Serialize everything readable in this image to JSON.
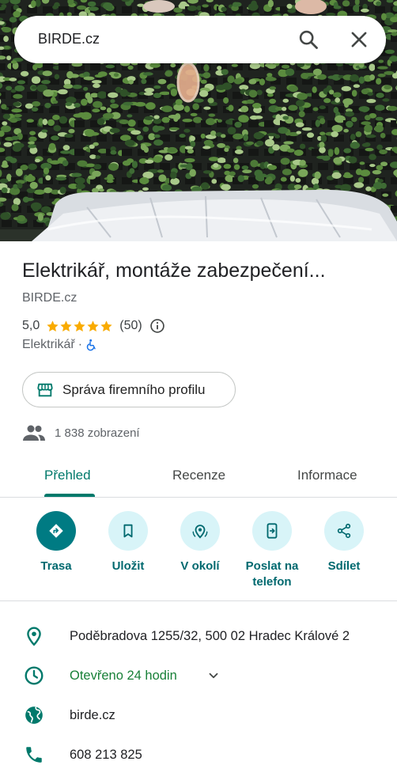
{
  "search": {
    "query": "BIRDE.cz"
  },
  "place": {
    "title": "Elektrikář, montáže zabezpečení...",
    "subtitle": "BIRDE.cz",
    "rating": "5,0",
    "review_count": "(50)",
    "category": "Elektrikář",
    "separator": "·",
    "manage_profile_label": "Správa firemního profilu",
    "views": "1 838 zobrazení"
  },
  "tabs": [
    {
      "label": "Přehled",
      "active": true
    },
    {
      "label": "Recenze",
      "active": false
    },
    {
      "label": "Informace",
      "active": false
    }
  ],
  "actions": [
    {
      "label": "Trasa",
      "icon": "directions-icon"
    },
    {
      "label": "Uložit",
      "icon": "bookmark-icon"
    },
    {
      "label": "V okolí",
      "icon": "nearby-icon"
    },
    {
      "label": "Poslat na telefon",
      "icon": "send-to-phone-icon"
    },
    {
      "label": "Sdílet",
      "icon": "share-icon"
    }
  ],
  "details": {
    "address": "Poděbradova 1255/32, 500 02 Hradec Králové 2",
    "hours": "Otevřeno 24 hodin",
    "website": "birde.cz",
    "phone": "608 213 825"
  },
  "colors": {
    "accent": "#00796b",
    "action_bg": "#d8f4f8",
    "action_primary": "#007b83",
    "open_green": "#188038",
    "star": "#f9ab00"
  }
}
